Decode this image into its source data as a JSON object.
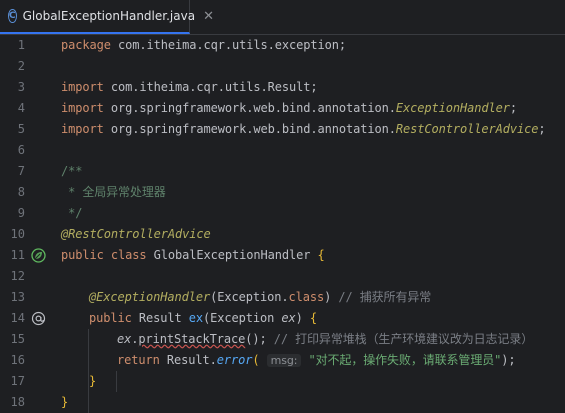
{
  "tab": {
    "icon": "class-icon",
    "icon_letter": "C",
    "title": "GlobalExceptionHandler.java",
    "close": "✕"
  },
  "lines": [
    {
      "n": "1"
    },
    {
      "n": "2"
    },
    {
      "n": "3"
    },
    {
      "n": "4"
    },
    {
      "n": "5"
    },
    {
      "n": "6"
    },
    {
      "n": "7"
    },
    {
      "n": "8"
    },
    {
      "n": "9"
    },
    {
      "n": "10"
    },
    {
      "n": "11"
    },
    {
      "n": "12"
    },
    {
      "n": "13"
    },
    {
      "n": "14"
    },
    {
      "n": "15"
    },
    {
      "n": "16"
    },
    {
      "n": "17"
    },
    {
      "n": "18"
    }
  ],
  "code": {
    "l1": {
      "kw": "package",
      "rest": " com.itheima.cqr.utils.exception;"
    },
    "l3": {
      "kw": "import",
      "rest": " com.itheima.cqr.utils.Result;"
    },
    "l4": {
      "kw": "import",
      "rest": " org.springframework.web.bind.annotation.",
      "cls": "ExceptionHandler",
      "end": ";"
    },
    "l5": {
      "kw": "import",
      "rest": " org.springframework.web.bind.annotation.",
      "cls": "RestControllerAdvice",
      "end": ";"
    },
    "l7": {
      "text": "/**"
    },
    "l8": {
      "text": " * 全局异常处理器"
    },
    "l9": {
      "text": " */"
    },
    "l10": {
      "ann": "@RestControllerAdvice"
    },
    "l11": {
      "kw1": "public",
      "kw2": "class",
      "name": " GlobalExceptionHandler ",
      "brace": "{"
    },
    "l13": {
      "ann": "@ExceptionHandler",
      "open": "(",
      "arg": "Exception.",
      "kw": "class",
      "close": ")",
      "comment": " // 捕获所有异常"
    },
    "l14": {
      "kw": "public",
      "type": " Result ",
      "method": "ex",
      "open": "(",
      "ptype": "Exception ",
      "param": "ex",
      "close": ")",
      "brace": " {"
    },
    "l15": {
      "obj": "ex",
      "dot": ".",
      "call": "printStackTrace",
      "args": "();",
      "comment": " // 打印异常堆栈（生产环境建议改为日志记录）"
    },
    "l16": {
      "kw": "return",
      "cls": " Result.",
      "call": "error",
      "open": "(",
      "hint": "msg:",
      "str": " \"对不起，操作失败，请联系管理员\"",
      "close": ");"
    },
    "l17": {
      "brace": "}"
    },
    "l18": {
      "brace": "}"
    }
  },
  "gutter": {
    "line11_icon": "bean-leaf-icon",
    "line14_icon": "at-annotation-icon"
  }
}
